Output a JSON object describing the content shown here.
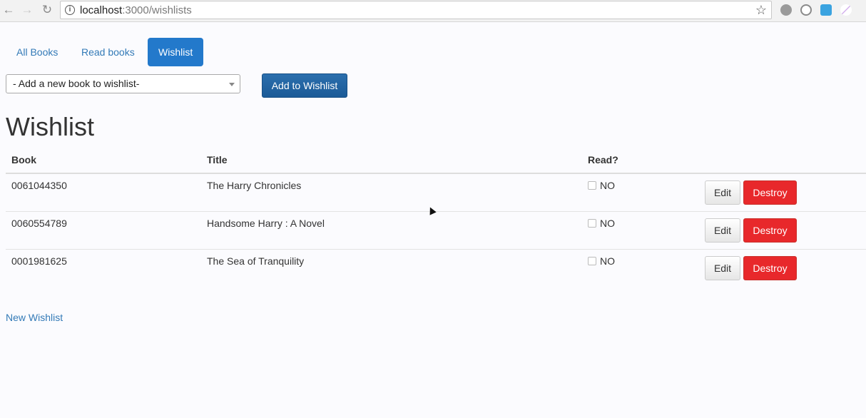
{
  "browser": {
    "url_host": "localhost",
    "url_path": ":3000/wishlists"
  },
  "nav": {
    "tabs": [
      "All Books",
      "Read books",
      "Wishlist"
    ],
    "active_index": 2
  },
  "add_form": {
    "select_value": "- Add a new book to wishlist-",
    "button_label": "Add to Wishlist"
  },
  "page_title": "Wishlist",
  "table": {
    "headers": [
      "Book",
      "Title",
      "Read?"
    ],
    "rows": [
      {
        "book": "0061044350",
        "title": "The Harry Chronicles",
        "read": "NO"
      },
      {
        "book": "0060554789",
        "title": "Handsome Harry : A Novel",
        "read": "NO"
      },
      {
        "book": "0001981625",
        "title": "The Sea of Tranquility",
        "read": "NO"
      }
    ],
    "edit_label": "Edit",
    "destroy_label": "Destroy"
  },
  "new_link": "New Wishlist",
  "colors": {
    "link": "#337ab7",
    "active_tab": "#2379cb",
    "primary_button": "#1b5a97",
    "danger_button": "#e8282b"
  }
}
